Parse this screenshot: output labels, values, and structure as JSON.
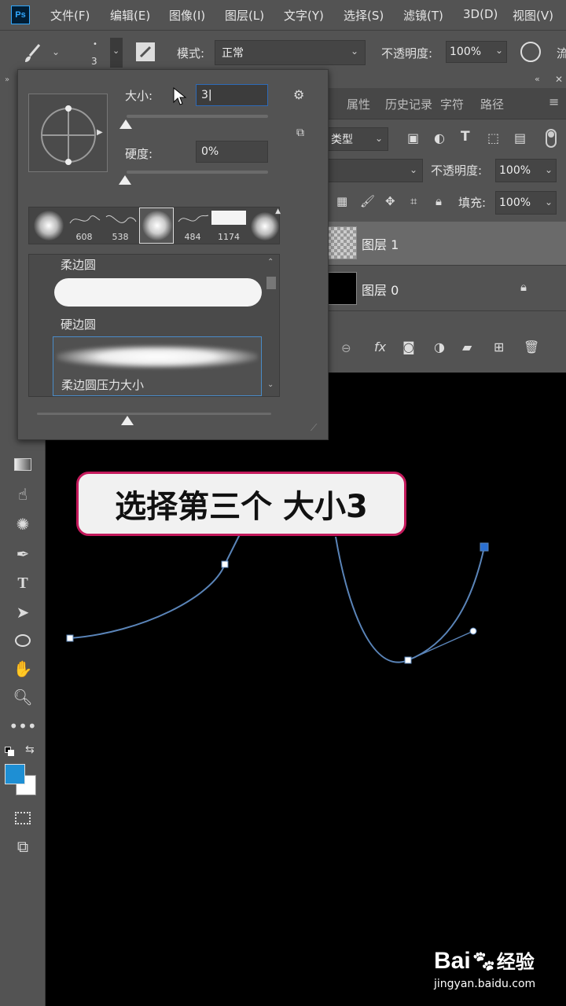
{
  "app": {
    "logo_text": "Ps"
  },
  "menu": [
    "文件(F)",
    "编辑(E)",
    "图像(I)",
    "图层(L)",
    "文字(Y)",
    "选择(S)",
    "滤镜(T)",
    "3D(D)",
    "视图(V)"
  ],
  "options_bar": {
    "brush_size_label": "3",
    "mode_label": "模式:",
    "mode_value": "正常",
    "opacity_label": "不透明度:",
    "opacity_value": "100%",
    "flow_label": "流"
  },
  "brush_popup": {
    "size_label": "大小:",
    "size_value": "3",
    "hardness_label": "硬度:",
    "hardness_value": "0%",
    "presets": [
      {
        "kind": "soft-round",
        "label": ""
      },
      {
        "kind": "stroke",
        "label": "608"
      },
      {
        "kind": "stroke",
        "label": "538"
      },
      {
        "kind": "soft-round-selected",
        "label": ""
      },
      {
        "kind": "stroke",
        "label": "484"
      },
      {
        "kind": "white-block",
        "label": "1174"
      },
      {
        "kind": "soft-round",
        "label": ""
      }
    ],
    "brush_list": [
      "柔边圆",
      "硬边圆",
      "柔边圆压力大小"
    ]
  },
  "panel_tabs": [
    "属性",
    "历史记录",
    "字符",
    "路径"
  ],
  "layers": {
    "filter_kind": "类型",
    "opacity_label": "不透明度:",
    "opacity_value": "100%",
    "fill_label": "填充:",
    "fill_value": "100%",
    "rows": [
      {
        "name": "图层 1",
        "selected": true,
        "locked": false
      },
      {
        "name": "图层 0",
        "selected": false,
        "locked": true
      }
    ]
  },
  "callout": {
    "text": "选择第三个 大小3"
  },
  "watermark": {
    "brand": "Bai",
    "brand2": "经验",
    "url": "jingyan.baidu.com"
  },
  "colors": {
    "foreground": "#1e8fd4",
    "background": "#ffffff",
    "callout_border": "#c41a5c",
    "path": "#5a84b8"
  }
}
